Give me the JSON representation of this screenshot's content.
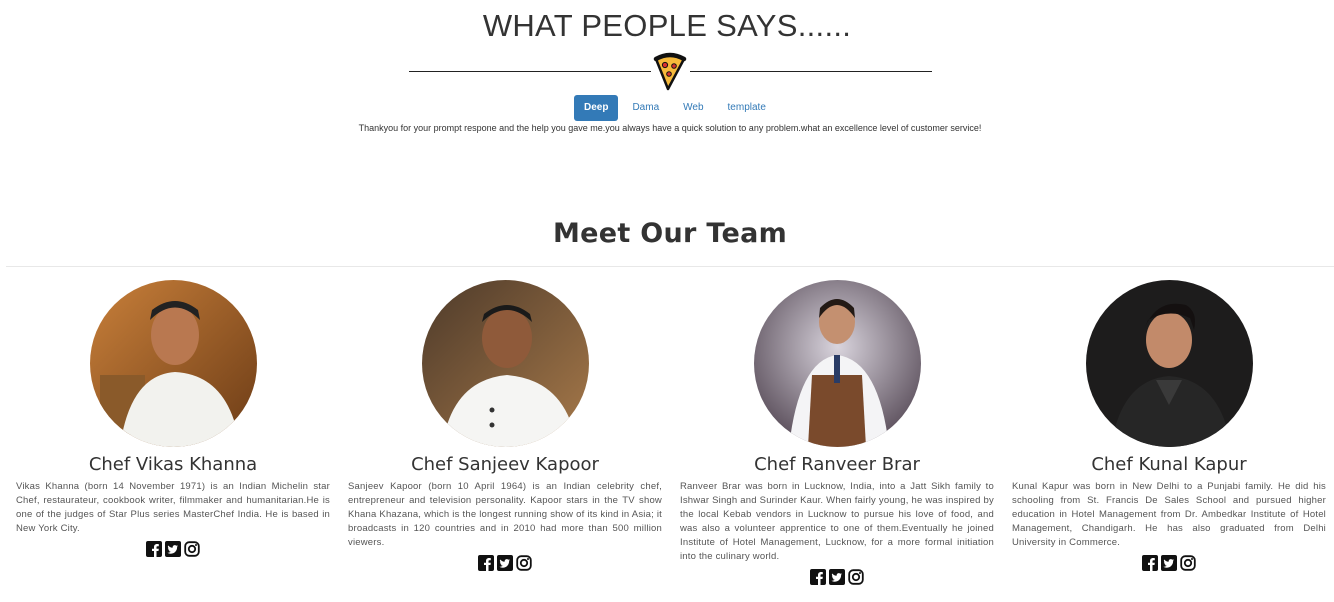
{
  "testimonials": {
    "title": "WHAT PEOPLE SAYS......",
    "tabs": [
      {
        "label": "Deep",
        "active": true
      },
      {
        "label": "Dama",
        "active": false
      },
      {
        "label": "Web",
        "active": false
      },
      {
        "label": "template",
        "active": false
      }
    ],
    "quote": "Thankyou for your prompt respone and the help you gave me.you always have a quick solution to any problem.what an excellence level of customer service!",
    "divider_icon": "pizza-icon"
  },
  "team": {
    "title": "Meet Our Team",
    "members": [
      {
        "name": "Chef Vikas Khanna",
        "bio": "Vikas Khanna (born 14 November 1971) is an Indian Michelin star Chef, restaurateur, cookbook writer, filmmaker and humanitarian.He is one of the judges of Star Plus series MasterChef India. He is based in New York City.",
        "socials": [
          "facebook-icon",
          "twitter-icon",
          "instagram-icon"
        ]
      },
      {
        "name": "Chef Sanjeev Kapoor",
        "bio": "Sanjeev Kapoor (born 10 April 1964) is an Indian celebrity chef, entrepreneur and television personality. Kapoor stars in the TV show Khana Khazana, which is the longest running show of its kind in Asia; it broadcasts in 120 countries and in 2010 had more than 500 million viewers.",
        "socials": [
          "facebook-icon",
          "twitter-icon",
          "instagram-icon"
        ]
      },
      {
        "name": "Chef Ranveer Brar",
        "bio": "Ranveer Brar was born in Lucknow, India, into a Jatt Sikh family to Ishwar Singh and Surinder Kaur. When fairly young, he was inspired by the local Kebab vendors in Lucknow to pursue his love of food, and was also a volunteer apprentice to one of them.Eventually he joined Institute of Hotel Management, Lucknow, for a more formal initiation into the culinary world.",
        "socials": [
          "facebook-icon",
          "twitter-icon",
          "instagram-icon"
        ]
      },
      {
        "name": "Chef Kunal Kapur",
        "bio": "Kunal Kapur was born in New Delhi to a Punjabi family. He did his schooling from St. Francis De Sales School and pursued higher education in Hotel Management from Dr. Ambedkar Institute of Hotel Management, Chandigarh. He has also graduated from Delhi University in Commerce.",
        "socials": [
          "facebook-icon",
          "twitter-icon",
          "instagram-icon"
        ]
      }
    ]
  }
}
